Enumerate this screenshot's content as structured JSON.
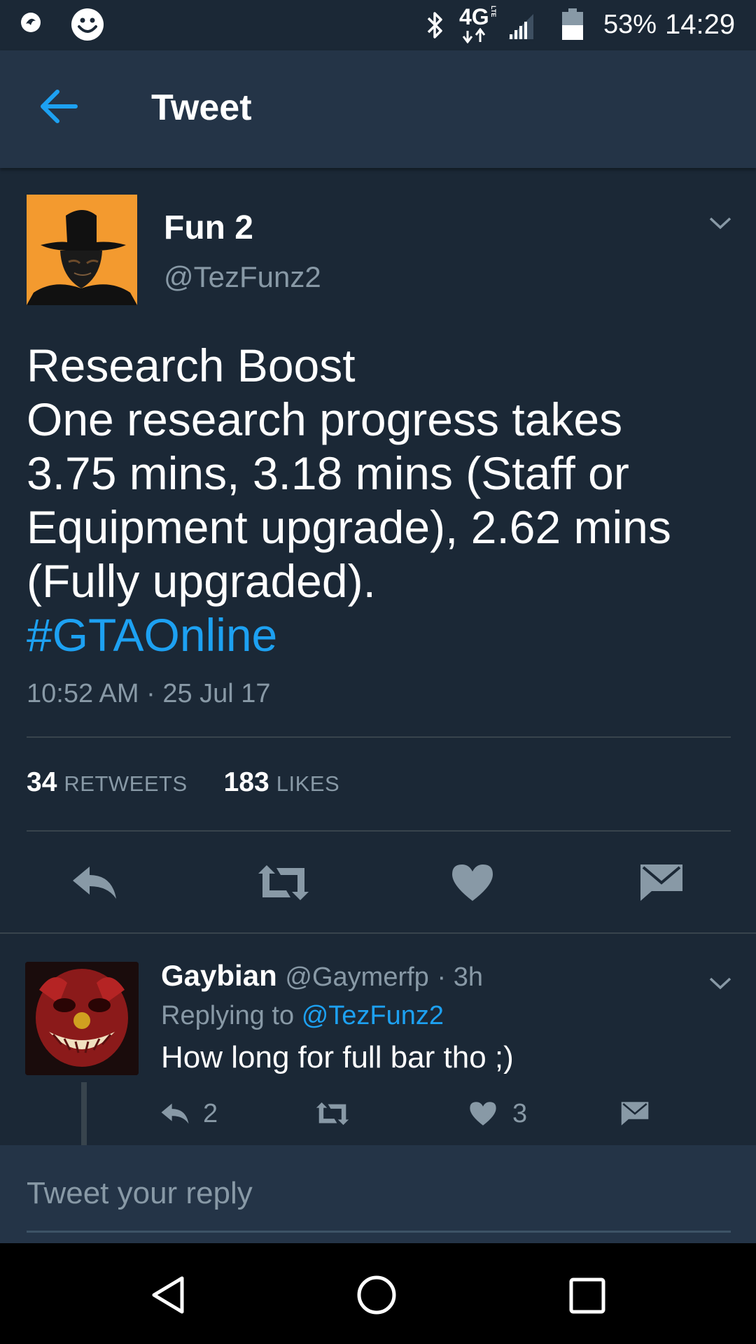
{
  "status_bar": {
    "network": "4G",
    "network_sub": "LTE",
    "battery": "53%",
    "time": "14:29",
    "icons": [
      "app-notification-icon",
      "smiley-icon",
      "bluetooth-icon",
      "data-arrows-icon",
      "signal-icon",
      "battery-icon"
    ]
  },
  "header": {
    "title": "Tweet",
    "back_icon": "back-arrow-icon"
  },
  "tweet": {
    "author_name": "Fun 2",
    "author_handle": "@TezFunz2",
    "lines": [
      "Research Boost",
      "One research progress takes",
      "3.75 mins, 3.18 mins (Staff or",
      "Equipment upgrade), 2.62 mins",
      "(Fully upgraded)."
    ],
    "hashtag": "#GTAOnline",
    "timestamp": "10:52 AM · 25 Jul 17",
    "retweet_count": "34",
    "retweet_label": "RETWEETS",
    "like_count": "183",
    "like_label": "LIKES"
  },
  "reply": {
    "author_name": "Gaybian",
    "author_handle": "@Gaymerfp",
    "age": "· 3h",
    "replying_prefix": "Replying to",
    "replying_to": "@TezFunz2",
    "text": "How long for full bar tho ;)",
    "reply_count": "2",
    "like_count": "3"
  },
  "compose": {
    "placeholder": "Tweet your reply"
  },
  "colors": {
    "background": "#1b2836",
    "header": "#243447",
    "accent": "#1da1f2",
    "muted": "#8899a6"
  }
}
